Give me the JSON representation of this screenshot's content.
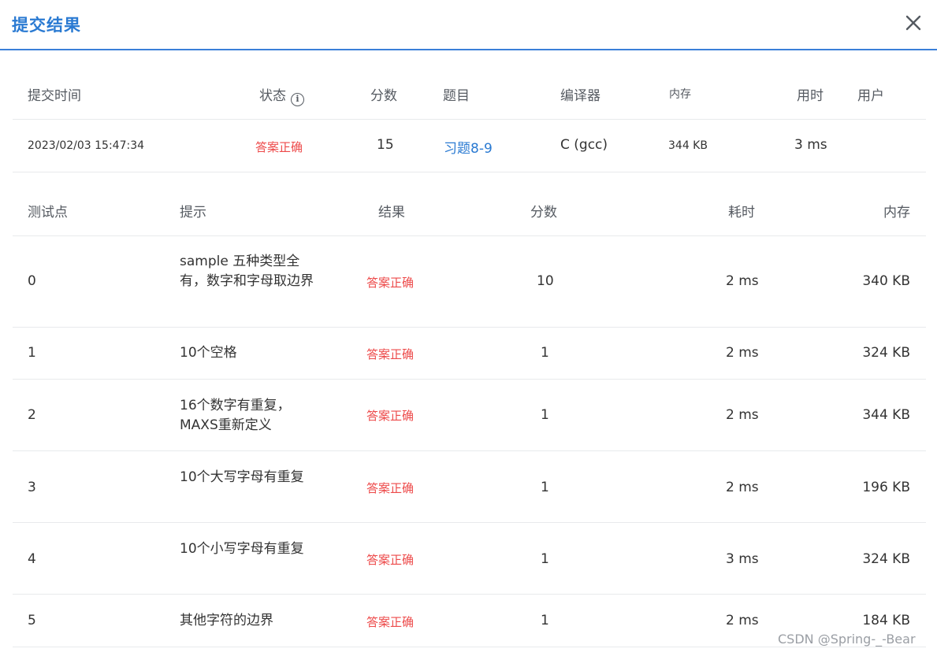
{
  "dialog": {
    "title": "提交结果",
    "close_icon": "close-icon"
  },
  "summary": {
    "headers": {
      "time": "提交时间",
      "status": "状态",
      "score": "分数",
      "problem": "题目",
      "compiler": "编译器",
      "memory": "内存",
      "duration": "用时",
      "user": "用户"
    },
    "status_info_icon": "info-icon",
    "row": {
      "time": "2023/02/03 15:47:34",
      "status": "答案正确",
      "score": "15",
      "problem": "习题8-9",
      "compiler": "C (gcc)",
      "memory": "344 KB",
      "duration": "3 ms",
      "user": ""
    }
  },
  "detail": {
    "headers": {
      "case": "测试点",
      "hint": "提示",
      "result": "结果",
      "score": "分数",
      "duration": "耗时",
      "memory": "内存"
    },
    "rows": [
      {
        "case": "0",
        "hint": "sample 五种类型全有，数字和字母取边界",
        "result": "答案正确",
        "score": "10",
        "duration": "2 ms",
        "memory": "340 KB"
      },
      {
        "case": "1",
        "hint": "10个空格",
        "result": "答案正确",
        "score": "1",
        "duration": "2 ms",
        "memory": "324 KB"
      },
      {
        "case": "2",
        "hint": "16个数字有重复，MAXS重新定义",
        "result": "答案正确",
        "score": "1",
        "duration": "2 ms",
        "memory": "344 KB"
      },
      {
        "case": "3",
        "hint": "10个大写字母有重复",
        "result": "答案正确",
        "score": "1",
        "duration": "2 ms",
        "memory": "196 KB"
      },
      {
        "case": "4",
        "hint": "10个小写字母有重复",
        "result": "答案正确",
        "score": "1",
        "duration": "3 ms",
        "memory": "324 KB"
      },
      {
        "case": "5",
        "hint": "其他字符的边界",
        "result": "答案正确",
        "score": "1",
        "duration": "2 ms",
        "memory": "184 KB"
      }
    ]
  },
  "watermark": "CSDN @Spring-_-Bear",
  "colors": {
    "accent": "#2a7ad2",
    "success_status": "#ed4a4a",
    "divider": "#e8eaec"
  }
}
